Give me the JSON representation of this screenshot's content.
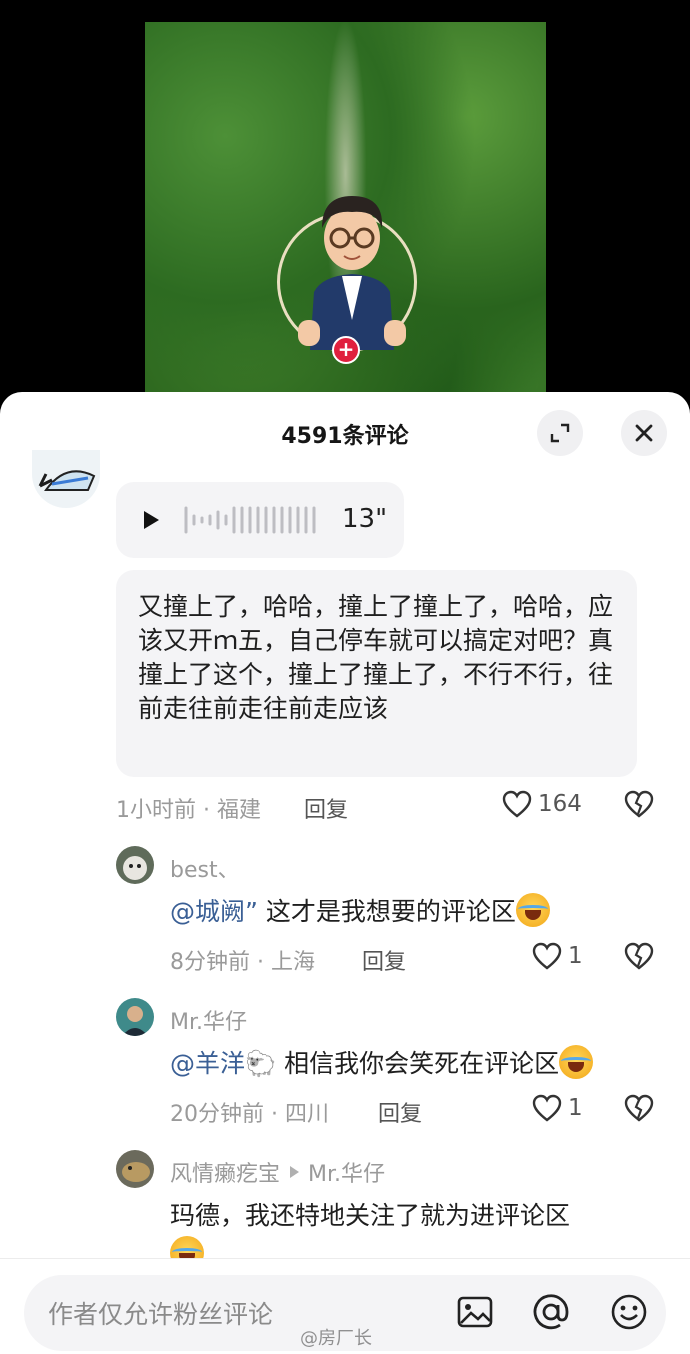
{
  "video": {
    "follow_plus": "+"
  },
  "sheet": {
    "title": "4591条评论"
  },
  "comment": {
    "voice_duration": "13\"",
    "text": "又撞上了，哈哈，撞上了撞上了，哈哈，应该又开ｍ五，自己停车就可以搞定对吧？真撞上了这个，撞上了撞上了，不行不行，往前走往前走往前走应该",
    "meta": "1小时前 · 福建",
    "reply": "回复",
    "likes": "164"
  },
  "replies": [
    {
      "user": "best、",
      "mention": "@城阙”",
      "text": " 这才是我想要的评论区",
      "meta": "8分钟前 · 上海",
      "reply": "回复",
      "likes": "1"
    },
    {
      "user": "Mr.华仔",
      "mention": "@羊洋🐑",
      "text": " 相信我你会笑死在评论区",
      "meta": "20分钟前 · 四川",
      "reply": "回复",
      "likes": "1"
    },
    {
      "user": "风情癞疙宝",
      "reply_to": "Mr.华仔",
      "text": "玛德，我还特地关注了就为进评论区"
    }
  ],
  "input": {
    "placeholder": "作者仅允许粉丝评论"
  },
  "watermark": "@房厂长",
  "icons": {
    "expand": "expand-icon",
    "close": "close-icon",
    "play": "play-icon",
    "like": "heart-icon",
    "dislike": "broken-heart-icon",
    "image": "image-icon",
    "at": "at-icon",
    "emoji": "smile-icon"
  },
  "colors": {
    "follow_red": "#e0203e",
    "mention_blue": "#3a5f95"
  }
}
